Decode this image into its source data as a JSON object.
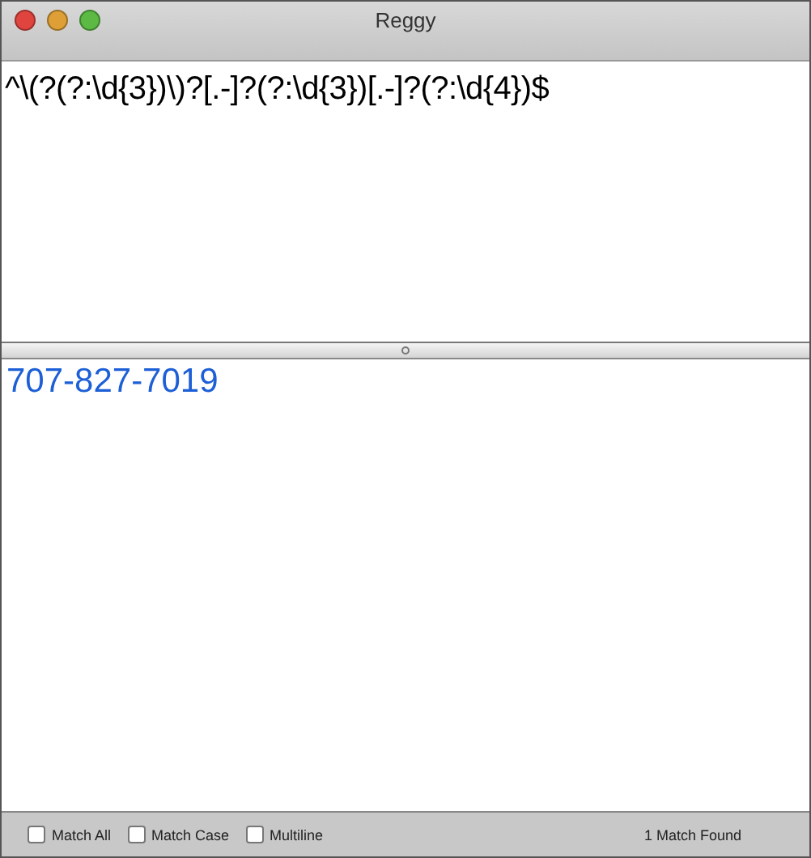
{
  "window": {
    "title": "Reggy"
  },
  "pattern": {
    "value": "^\\(?(?:\\d{3})\\)?[.-]?(?:\\d{3})[.-]?(?:\\d{4})$"
  },
  "test_text": {
    "matches": [
      "707-827-7019"
    ]
  },
  "options": [
    {
      "label": "Match All",
      "checked": false
    },
    {
      "label": "Match Case",
      "checked": false
    },
    {
      "label": "Multiline",
      "checked": false
    }
  ],
  "status": "1 Match Found"
}
